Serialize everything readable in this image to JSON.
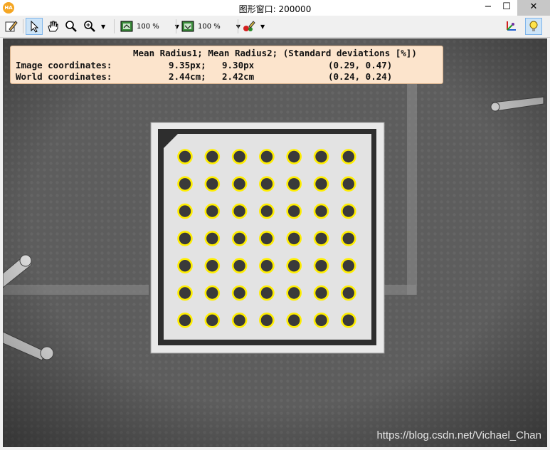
{
  "window": {
    "title": "图形窗口: 200000",
    "app_icon_text": "HA",
    "minimize_glyph": "−",
    "maximize_glyph": "☐",
    "close_glyph": "✕"
  },
  "toolbar": {
    "zoom_window": "100 %",
    "zoom_image": "100 %",
    "items": [
      "edit-icon",
      "pointer-icon",
      "hand-icon",
      "magnify-icon",
      "zoom-in-icon",
      "zoom-window-icon",
      "zoom-image-icon",
      "paint-icon",
      "coordinate-axes-icon",
      "lightbulb-icon"
    ],
    "active_item": "pointer-icon"
  },
  "overlay": {
    "header": "Mean Radius1; Mean Radius2; (Standard deviations [%])",
    "image_row": {
      "label": "Image coordinates:",
      "r1": "9.35px;",
      "r2": "9.30px",
      "dev": "(0.29, 0.47)"
    },
    "world_row": {
      "label": "World coordinates:",
      "r1": "2.44cm;",
      "r2": "2.42cm",
      "dev": "(0.24, 0.24)"
    }
  },
  "calibration_plate": {
    "rows": 7,
    "cols": 7,
    "marker_outline_color": "#ffee00",
    "marker_fill_color": "#3a3a3a"
  },
  "colors": {
    "background": "#5f5f5f",
    "plate_border": "#2e2e2e",
    "plate_surface": "#e3e3e3",
    "overlay_bg": "#fce4cc"
  },
  "watermark": "https://blog.csdn.net/Vichael_Chan"
}
